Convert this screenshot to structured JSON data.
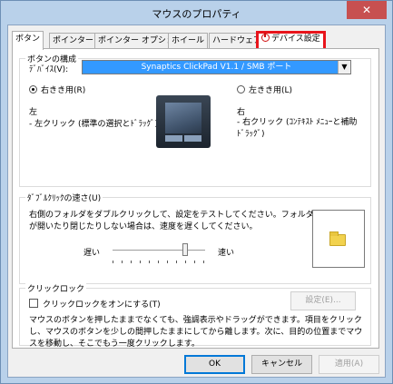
{
  "window": {
    "title": "マウスのプロパティ",
    "close_label": "✕"
  },
  "tabs": [
    {
      "label": "ボタン"
    },
    {
      "label": "ポインター"
    },
    {
      "label": "ポインター オプション"
    },
    {
      "label": "ホイール"
    },
    {
      "label": "ハードウェア"
    },
    {
      "label": "デバイス設定"
    }
  ],
  "button_config": {
    "group_label": "ボタンの構成",
    "device_label": "ﾃﾞﾊﾞｲｽ(V):",
    "device_value": "Synaptics ClickPad V1.1 / SMB ポート",
    "right_handed_label": "右きき用(R)",
    "left_handed_label": "左きき用(L)",
    "left_side_title": "左",
    "left_side_desc": "- 左クリック (標準の選択とﾄﾞﾗｯｸﾞ)",
    "right_side_title": "右",
    "right_side_desc": "- 右クリック (ｺﾝﾃｷｽﾄ ﾒﾆｭｰと補助ﾄﾞﾗｯｸﾞ)"
  },
  "double_click": {
    "group_label": "ﾀﾞﾌﾞﾙｸﾘｯｸの速さ(U)",
    "description": "右側のフォルダをダブルクリックして、設定をテストしてください。フォルダが開いたり閉じたりしない場合は、速度を遅くしてください。",
    "slow_label": "遅い",
    "fast_label": "速い",
    "speed_value": 0.78
  },
  "click_lock": {
    "group_label": "クリックロック",
    "checkbox_label": "クリックロックをオンにする(T)",
    "settings_button": "設定(E)...",
    "description": "マウスのボタンを押したままでなくても、強調表示やドラッグができます。項目をクリックし、マウスのボタンを少しの間押したままにしてから離します。次に、目的の位置までマウスを移動し、そこでもう一度クリックします。"
  },
  "footer": {
    "ok_label": "OK",
    "cancel_label": "キャンセル",
    "apply_label": "適用(A)"
  },
  "colors": {
    "highlight_border": "#e8141b",
    "selection": "#3399ff",
    "close_button": "#c75050"
  }
}
